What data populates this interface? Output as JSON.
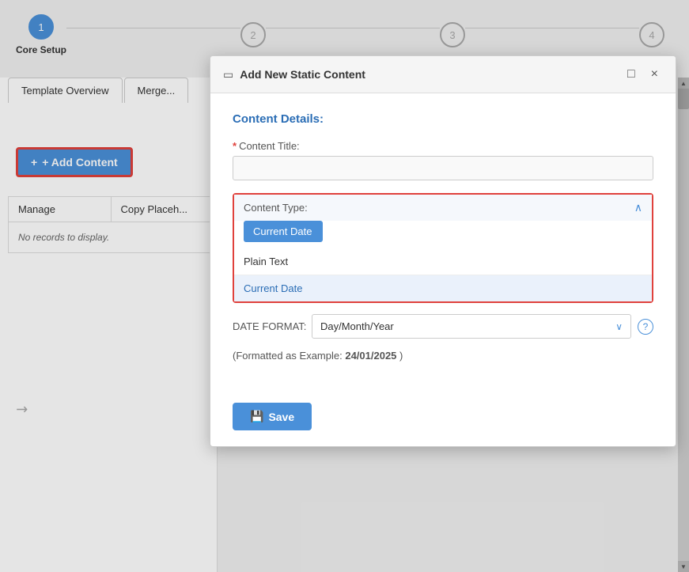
{
  "wizard": {
    "steps": [
      {
        "number": "1",
        "label": "Core Setup",
        "active": true
      },
      {
        "number": "2",
        "label": "",
        "active": false
      },
      {
        "number": "3",
        "label": "",
        "active": false
      },
      {
        "number": "4",
        "label": "",
        "active": false
      }
    ]
  },
  "tabs": [
    {
      "label": "Template Overview",
      "active": true
    },
    {
      "label": "Merge...",
      "active": false
    }
  ],
  "add_content_button": "+ Add Content",
  "table": {
    "columns": [
      "Manage",
      "Copy Placeh..."
    ],
    "empty_message": "No records to display."
  },
  "modal": {
    "title": "Add New Static Content",
    "icon": "▭",
    "maximize_label": "□",
    "close_label": "×",
    "section_title": "Content Details:",
    "content_title_label": "Content Title:",
    "content_title_placeholder": "",
    "content_type_label": "Content Type:",
    "content_type_selected": "Current Date",
    "dropdown_options": [
      {
        "label": "Plain Text",
        "highlighted": false
      },
      {
        "label": "Current Date",
        "highlighted": true
      }
    ],
    "date_format_label": "DATE FORMAT:",
    "date_format_value": "Day/Month/Year",
    "format_example_prefix": "(Formatted as Example:",
    "format_example_value": "24/01/2025",
    "format_example_suffix": ")",
    "save_label": "Save"
  }
}
